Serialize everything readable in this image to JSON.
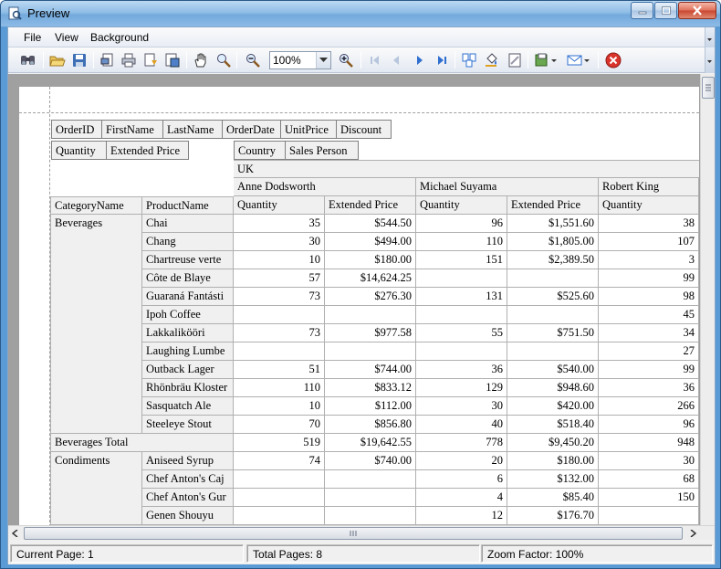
{
  "window": {
    "title": "Preview"
  },
  "menu": {
    "file": "File",
    "view": "View",
    "background": "Background"
  },
  "toolbar": {
    "zoom_value": "100%"
  },
  "fields": {
    "row1": [
      "OrderID",
      "FirstName",
      "LastName",
      "OrderDate",
      "UnitPrice",
      "Discount"
    ],
    "data_fields": [
      "Quantity",
      "Extended Price"
    ],
    "column_fields": [
      "Country",
      "Sales Person"
    ]
  },
  "grid": {
    "country": "UK",
    "sales_persons": [
      "Anne Dodsworth",
      "Michael Suyama",
      "Robert King"
    ],
    "row_headers": [
      "CategoryName",
      "ProductName"
    ],
    "measure_headers": [
      "Quantity",
      "Extended Price",
      "Quantity",
      "Extended Price",
      "Quantity"
    ],
    "rows": [
      {
        "category": "Beverages",
        "product": "Chai",
        "v": [
          "35",
          "$544.50",
          "96",
          "$1,551.60",
          "38"
        ]
      },
      {
        "category": "",
        "product": "Chang",
        "v": [
          "30",
          "$494.00",
          "110",
          "$1,805.00",
          "107"
        ]
      },
      {
        "category": "",
        "product": "Chartreuse verte",
        "v": [
          "10",
          "$180.00",
          "151",
          "$2,389.50",
          "3"
        ]
      },
      {
        "category": "",
        "product": "Côte de Blaye",
        "v": [
          "57",
          "$14,624.25",
          "",
          "",
          "99"
        ]
      },
      {
        "category": "",
        "product": "Guaraná Fantásti",
        "v": [
          "73",
          "$276.30",
          "131",
          "$525.60",
          "98"
        ]
      },
      {
        "category": "",
        "product": "Ipoh Coffee",
        "v": [
          "",
          "",
          "",
          "",
          "45"
        ]
      },
      {
        "category": "",
        "product": "Lakkalikööri",
        "v": [
          "73",
          "$977.58",
          "55",
          "$751.50",
          "34"
        ]
      },
      {
        "category": "",
        "product": "Laughing Lumbe",
        "v": [
          "",
          "",
          "",
          "",
          "27"
        ]
      },
      {
        "category": "",
        "product": "Outback Lager",
        "v": [
          "51",
          "$744.00",
          "36",
          "$540.00",
          "99"
        ]
      },
      {
        "category": "",
        "product": "Rhönbräu Kloster",
        "v": [
          "110",
          "$833.12",
          "129",
          "$948.60",
          "36"
        ]
      },
      {
        "category": "",
        "product": "Sasquatch Ale",
        "v": [
          "10",
          "$112.00",
          "30",
          "$420.00",
          "266"
        ]
      },
      {
        "category": "",
        "product": "Steeleye Stout",
        "v": [
          "70",
          "$856.80",
          "40",
          "$518.40",
          "96"
        ]
      },
      {
        "category": "Beverages Total",
        "product": "",
        "total": true,
        "v": [
          "519",
          "$19,642.55",
          "778",
          "$9,450.20",
          "948"
        ]
      },
      {
        "category": "Condiments",
        "product": "Aniseed Syrup",
        "v": [
          "74",
          "$740.00",
          "20",
          "$180.00",
          "30"
        ]
      },
      {
        "category": "",
        "product": "Chef Anton's Caj",
        "v": [
          "",
          "",
          "6",
          "$132.00",
          "68"
        ]
      },
      {
        "category": "",
        "product": "Chef Anton's Gur",
        "v": [
          "",
          "",
          "4",
          "$85.40",
          "150"
        ]
      },
      {
        "category": "",
        "product": "Genen Shouyu",
        "v": [
          "",
          "",
          "12",
          "$176.70",
          ""
        ]
      }
    ]
  },
  "status": {
    "current_page": "Current Page: 1",
    "total_pages": "Total Pages: 8",
    "zoom_factor": "Zoom Factor: 100%"
  }
}
